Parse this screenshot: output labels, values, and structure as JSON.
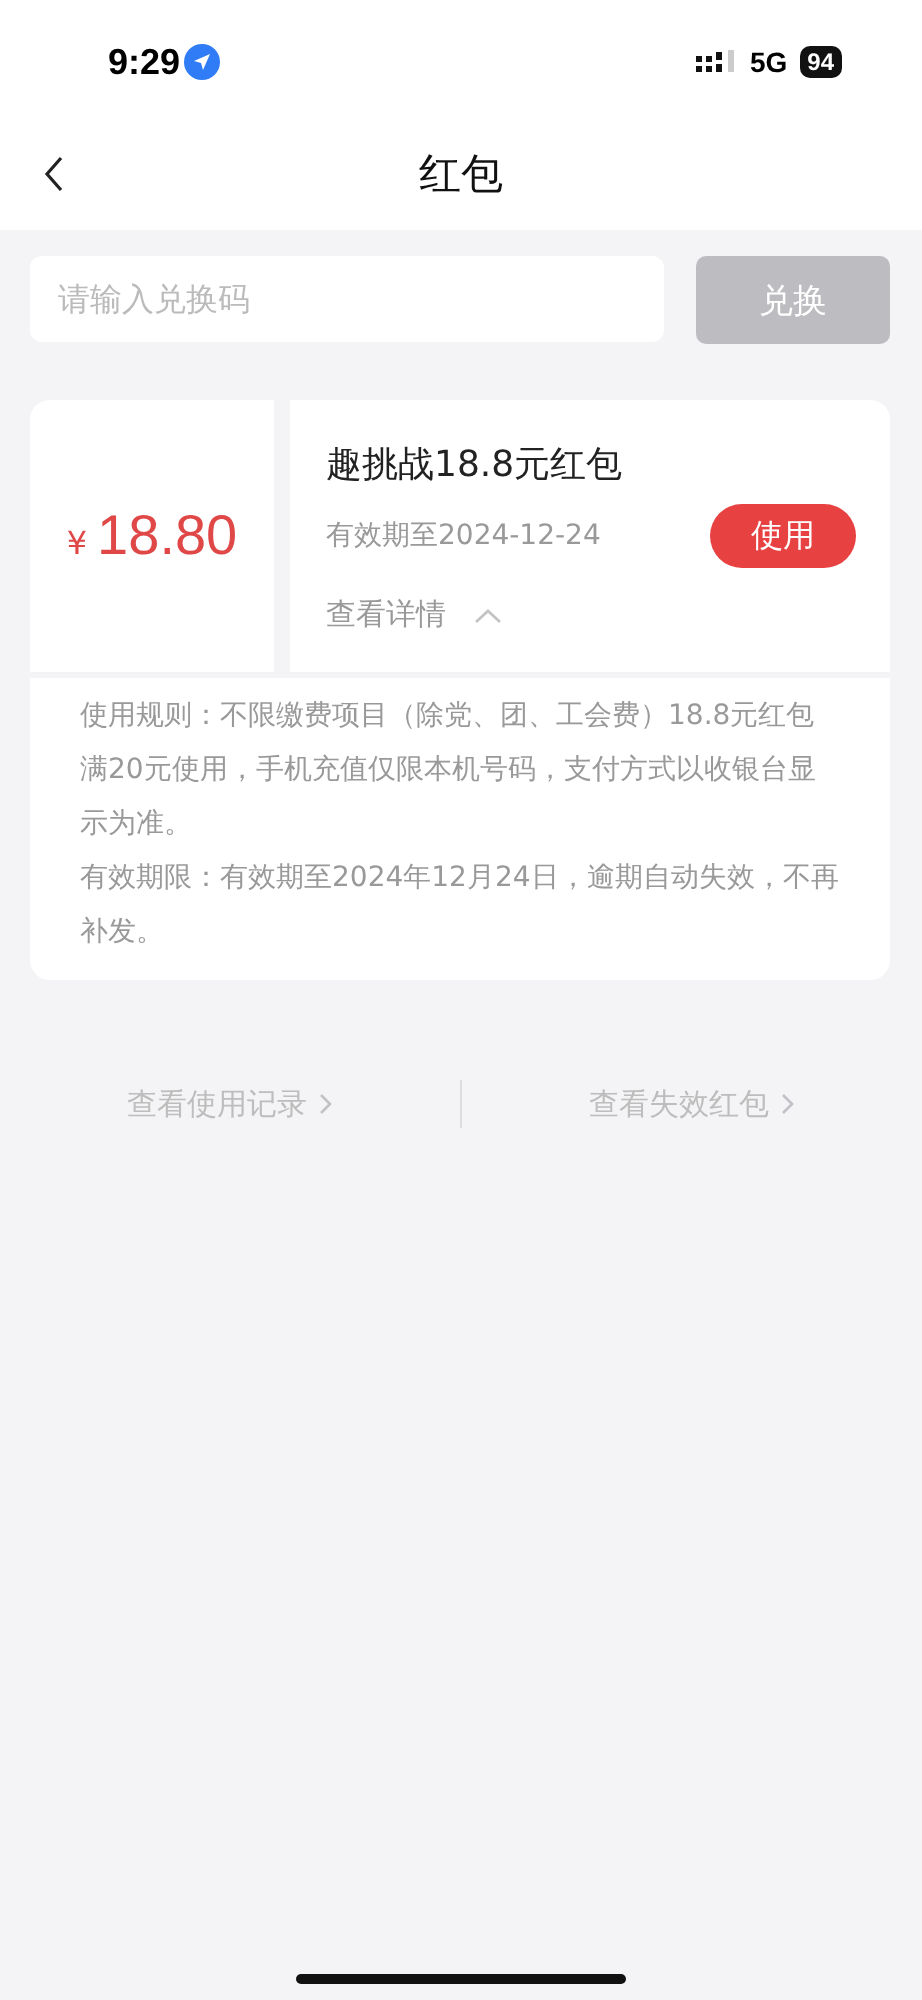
{
  "status_bar": {
    "time": "9:29",
    "network": "5G",
    "battery": "94"
  },
  "header": {
    "title": "红包"
  },
  "redeem": {
    "placeholder": "请输入兑换码",
    "button": "兑换",
    "disabled": true
  },
  "coupon": {
    "currency": "¥",
    "amount": "18.80",
    "title": "趣挑战18.8元红包",
    "expiry": "有效期至2024-12-24",
    "action": "使用",
    "details_label": "查看详情",
    "expanded": true,
    "rules": [
      "使用规则：不限缴费项目（除党、团、工会费）18.8元红包满20元使用，手机充值仅限本机号码，支付方式以收银台显示为准。",
      "有效期限：有效期至2024年12月24日，逾期自动失效，不再补发。"
    ]
  },
  "links": [
    {
      "label": "查看使用记录"
    },
    {
      "label": "查看失效红包"
    }
  ]
}
